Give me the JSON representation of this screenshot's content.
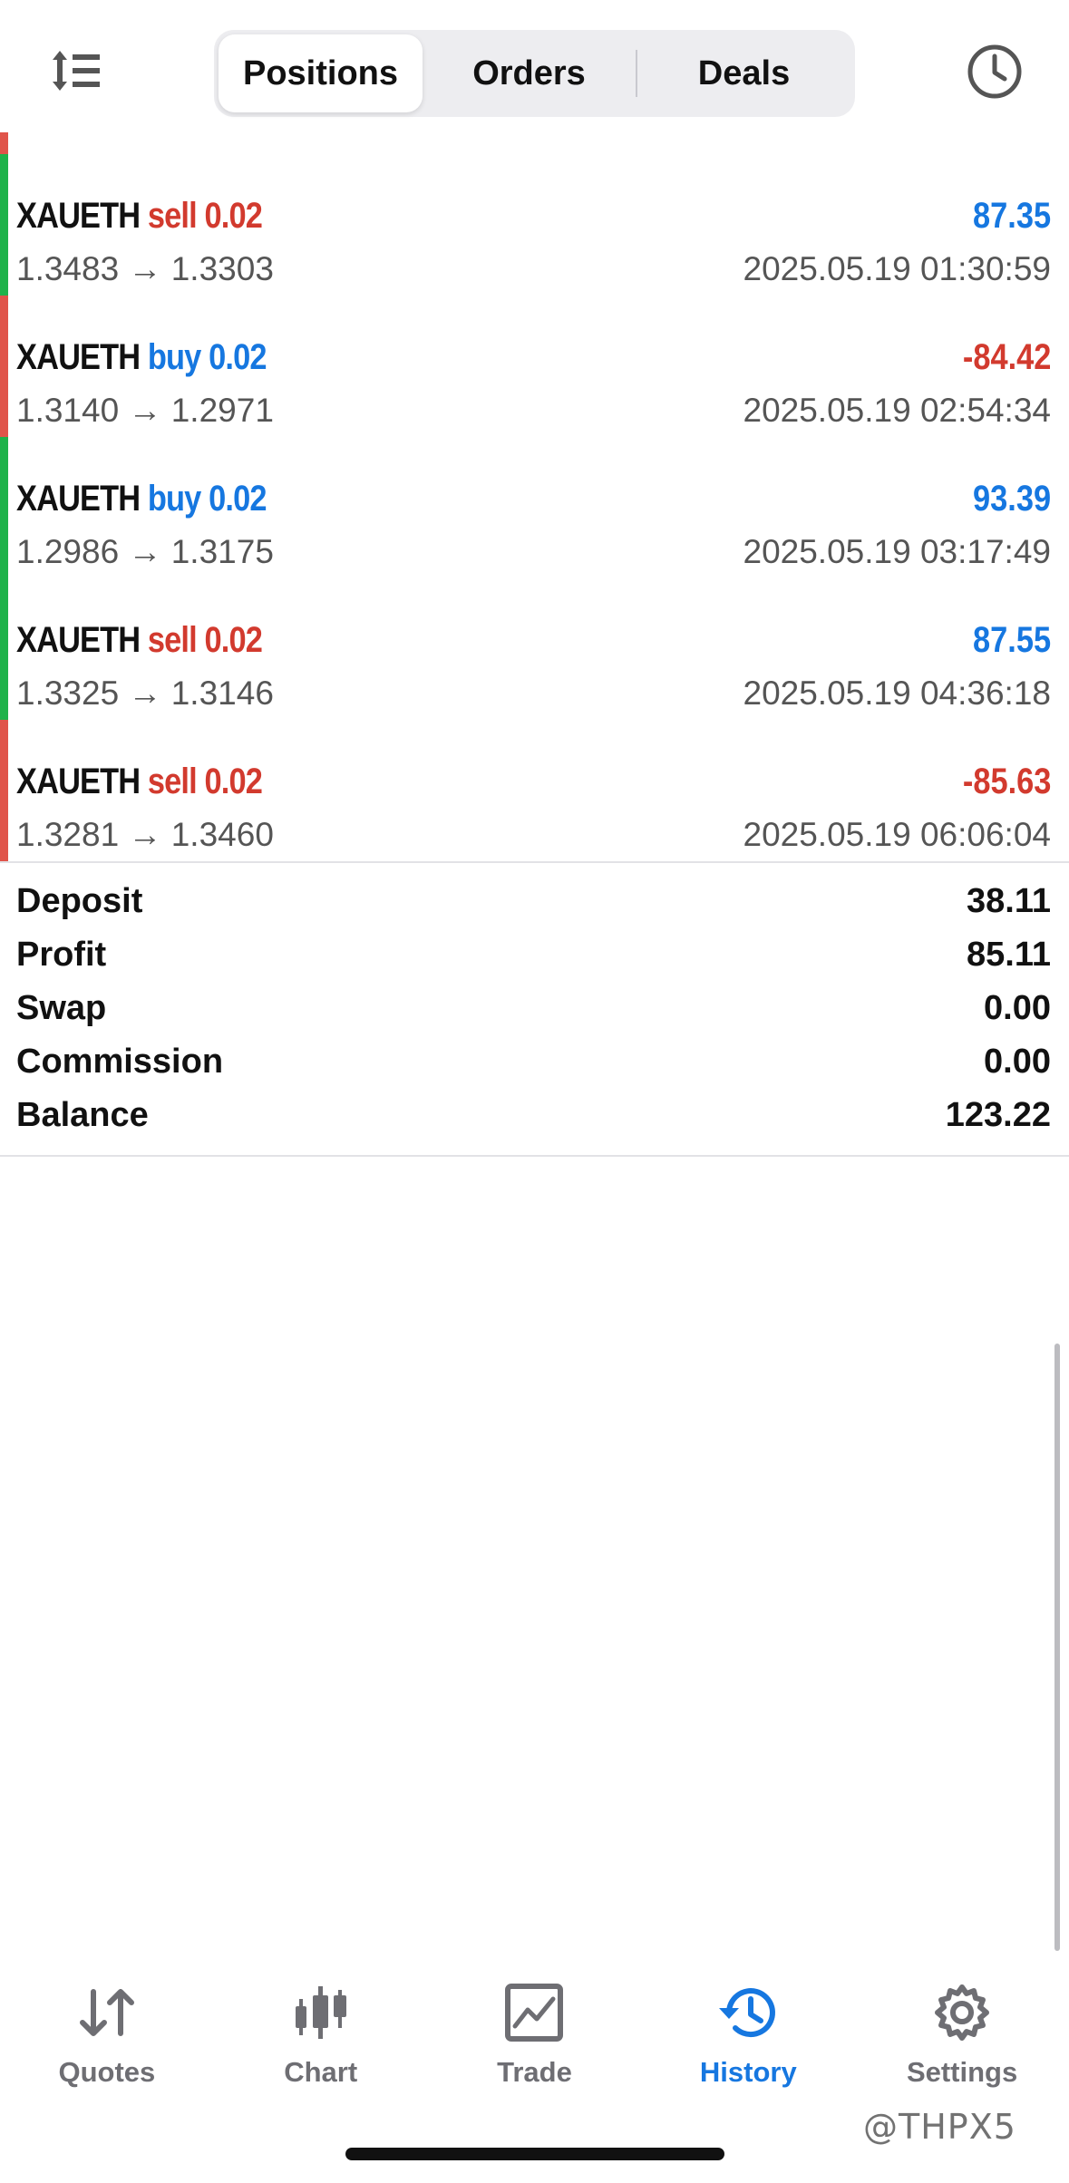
{
  "header": {
    "tabs": [
      {
        "label": "Positions",
        "active": true
      },
      {
        "label": "Orders",
        "active": false
      },
      {
        "label": "Deals",
        "active": false
      }
    ],
    "left_icon": "sort-icon",
    "right_icon": "clock-icon"
  },
  "colors": {
    "profit_positive": "#1677e0",
    "profit_negative": "#d23a2e",
    "bar_green": "#1fb24a",
    "bar_red": "#e0544a",
    "accent": "#1677e0"
  },
  "deals": [
    {
      "symbol": "XAUETH",
      "side": "sell 0.02",
      "side_type": "sell",
      "prices": "1.3483 → 1.3303",
      "profit": "87.35",
      "profit_sign": "positive",
      "time": "2025.05.19 01:30:59"
    },
    {
      "symbol": "XAUETH",
      "side": "buy 0.02",
      "side_type": "buy",
      "prices": "1.3140 → 1.2971",
      "profit": "-84.42",
      "profit_sign": "negative",
      "time": "2025.05.19 02:54:34"
    },
    {
      "symbol": "XAUETH",
      "side": "buy 0.02",
      "side_type": "buy",
      "prices": "1.2986 → 1.3175",
      "profit": "93.39",
      "profit_sign": "positive",
      "time": "2025.05.19 03:17:49"
    },
    {
      "symbol": "XAUETH",
      "side": "sell 0.02",
      "side_type": "sell",
      "prices": "1.3325 → 1.3146",
      "profit": "87.55",
      "profit_sign": "positive",
      "time": "2025.05.19 04:36:18"
    },
    {
      "symbol": "XAUETH",
      "side": "sell 0.02",
      "side_type": "sell",
      "prices": "1.3281 → 1.3460",
      "profit": "-85.63",
      "profit_sign": "negative",
      "time": "2025.05.19 06:06:04"
    }
  ],
  "summary": [
    {
      "label": "Deposit",
      "value": "38.11"
    },
    {
      "label": "Profit",
      "value": "85.11"
    },
    {
      "label": "Swap",
      "value": "0.00"
    },
    {
      "label": "Commission",
      "value": "0.00"
    },
    {
      "label": "Balance",
      "value": "123.22"
    }
  ],
  "tabbar": [
    {
      "label": "Quotes",
      "icon": "quotes-icon",
      "active": false
    },
    {
      "label": "Chart",
      "icon": "candlestick-chart-icon",
      "active": false
    },
    {
      "label": "Trade",
      "icon": "trade-chart-icon",
      "active": false
    },
    {
      "label": "History",
      "icon": "history-icon",
      "active": true
    },
    {
      "label": "Settings",
      "icon": "gear-icon",
      "active": false
    }
  ],
  "watermark": "@THPX5"
}
